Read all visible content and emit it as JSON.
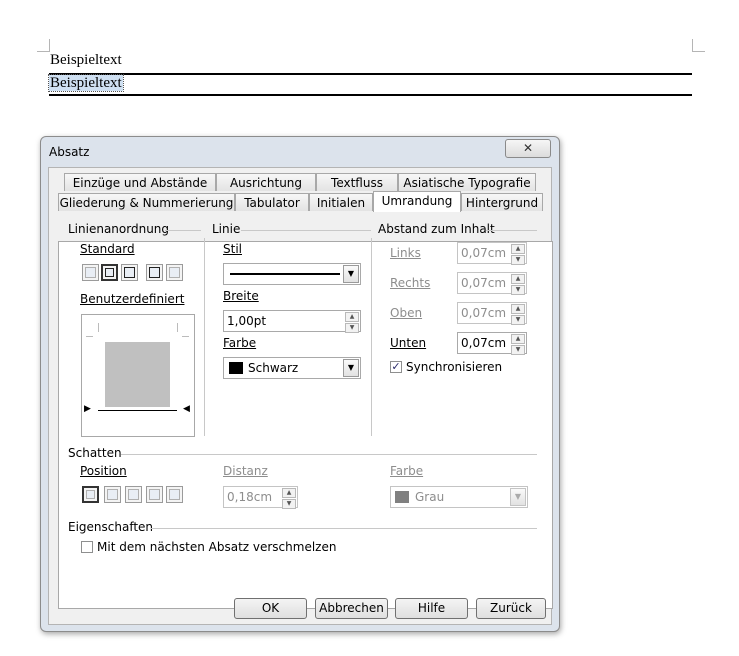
{
  "document": {
    "line1": "Beispieltext",
    "line2": "Beispieltext"
  },
  "dialog": {
    "title": "Absatz",
    "close_glyph": "✕",
    "tabs_row1": [
      "Einzüge und Abstände",
      "Ausrichtung",
      "Textfluss",
      "Asiatische Typografie"
    ],
    "tabs_row2": [
      "Gliederung & Nummerierung",
      "Tabulator",
      "Initialen",
      "Umrandung",
      "Hintergrund"
    ],
    "active_tab": "Umrandung",
    "line_arrangement": {
      "heading": "Linienanordnung",
      "default_label": "Standard",
      "custom_label": "Benutzerdefiniert"
    },
    "line": {
      "heading": "Linie",
      "style_label": "Stil",
      "width_label": "Breite",
      "width_value": "1,00pt",
      "color_label": "Farbe",
      "color_value": "Schwarz",
      "color_swatch": "#000000"
    },
    "spacing": {
      "heading": "Abstand zum Inhalt",
      "left_label": "Links",
      "left_value": "0,07cm",
      "right_label": "Rechts",
      "right_value": "0,07cm",
      "top_label": "Oben",
      "top_value": "0,07cm",
      "bottom_label": "Unten",
      "bottom_value": "0,07cm",
      "sync_label": "Synchronisieren",
      "sync_checked": true
    },
    "shadow": {
      "heading": "Schatten",
      "position_label": "Position",
      "distance_label": "Distanz",
      "distance_value": "0,18cm",
      "color_label": "Farbe",
      "color_value": "Grau",
      "color_swatch": "#808080"
    },
    "properties": {
      "heading": "Eigenschaften",
      "merge_label": "Mit dem nächsten Absatz verschmelzen",
      "merge_checked": false
    },
    "buttons": {
      "ok": "OK",
      "cancel": "Abbrechen",
      "help": "Hilfe",
      "reset": "Zurück"
    }
  }
}
